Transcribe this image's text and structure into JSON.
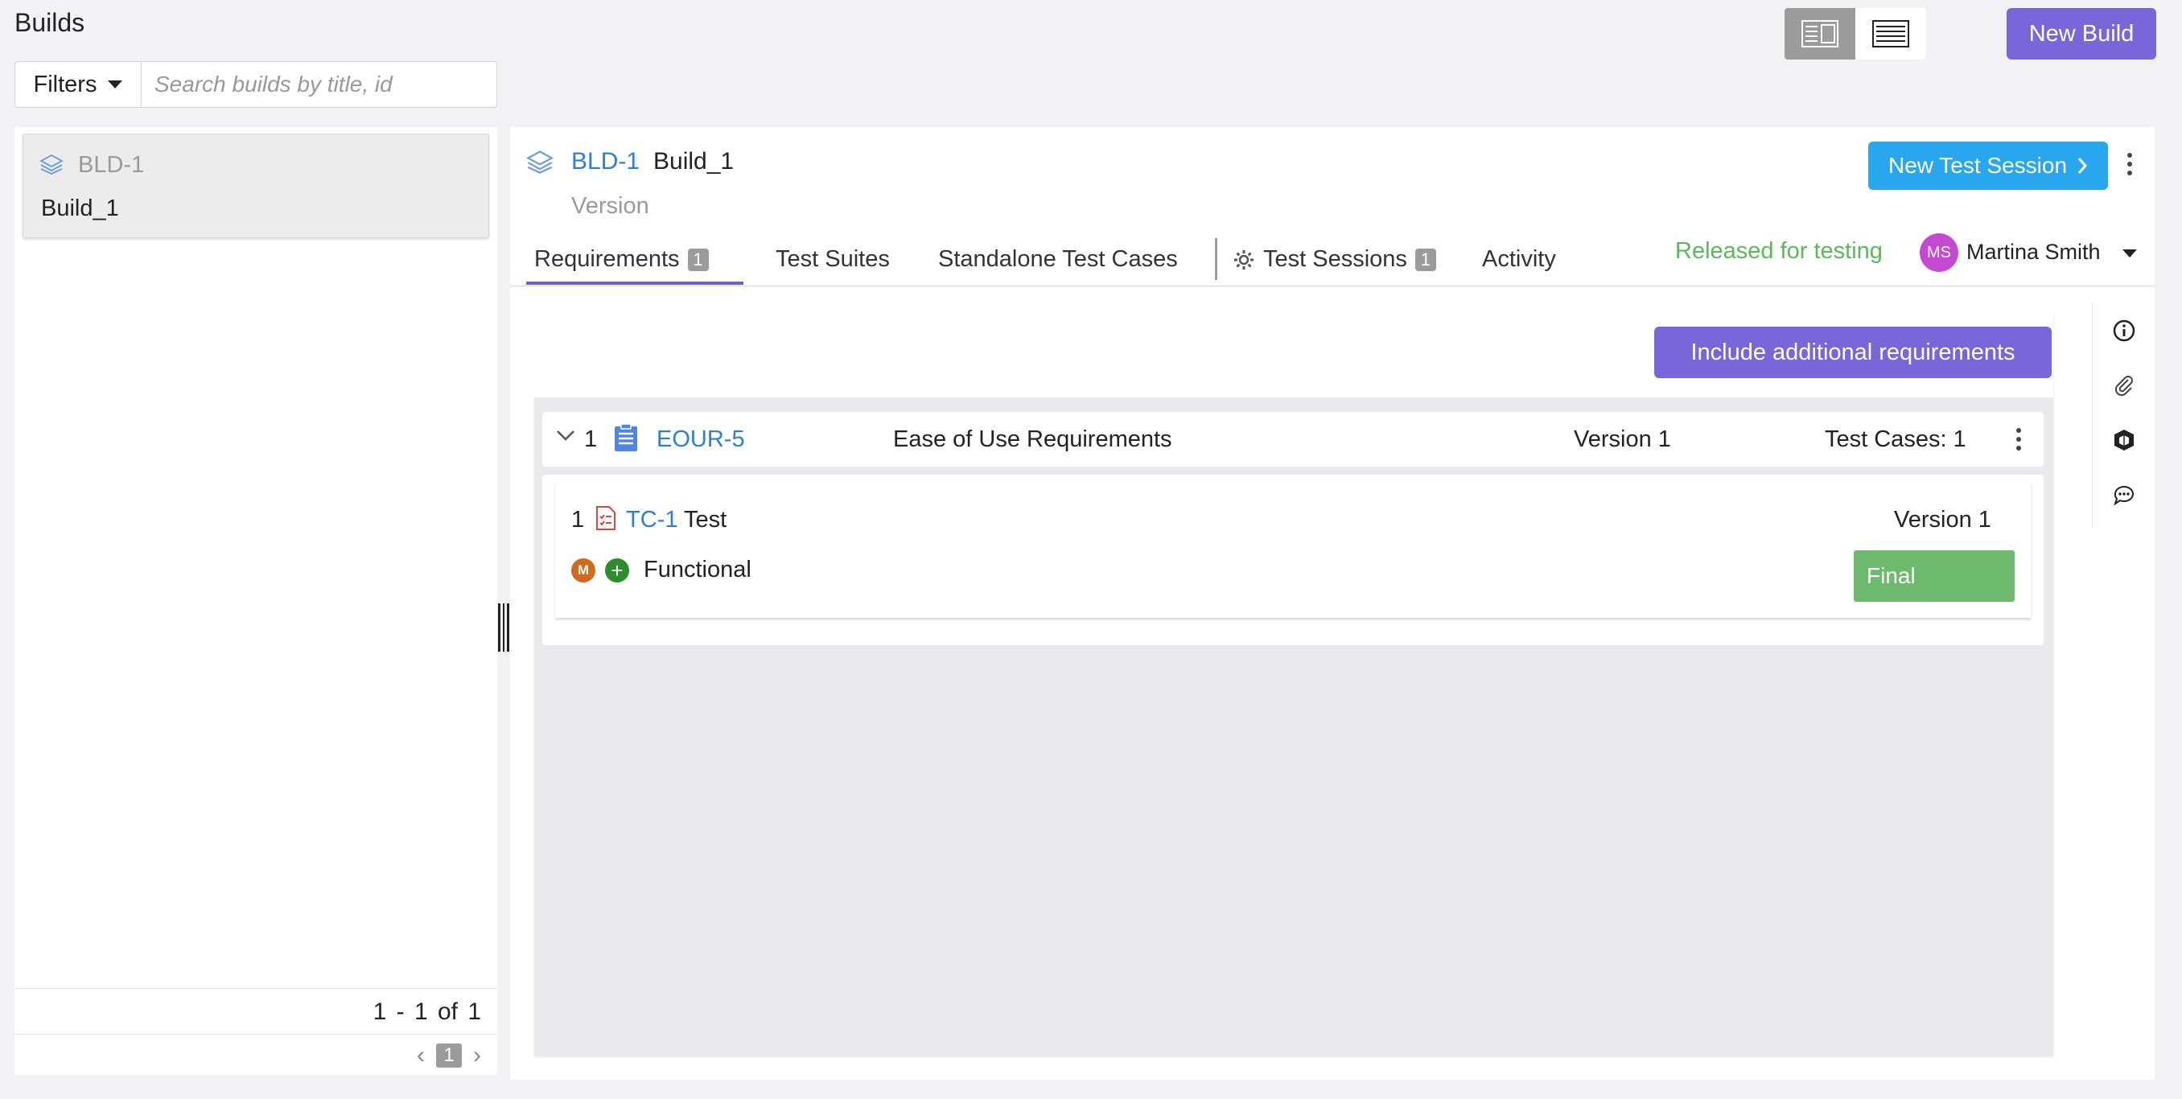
{
  "page": {
    "title": "Builds"
  },
  "toolbar": {
    "filters_label": "Filters",
    "search_placeholder": "Search builds by title, id",
    "new_build_label": "New Build"
  },
  "build_list": {
    "items": [
      {
        "id": "BLD-1",
        "name": "Build_1"
      }
    ],
    "count_text": "1 - 1  of  1",
    "current_page": "1"
  },
  "build_detail": {
    "id": "BLD-1",
    "name": "Build_1",
    "version_label": "Version",
    "new_session_label": "New Test Session",
    "status": "Released for testing",
    "owner": {
      "initials": "MS",
      "name": "Martina Smith"
    },
    "tabs": [
      {
        "label": "Requirements",
        "badge": "1"
      },
      {
        "label": "Test Suites"
      },
      {
        "label": "Standalone Test Cases"
      },
      {
        "label": "Test Sessions",
        "badge": "1"
      },
      {
        "label": "Activity"
      }
    ],
    "include_btn_label": "Include additional requirements"
  },
  "requirement": {
    "index": "1",
    "id": "EOUR-5",
    "title": "Ease of Use Requirements",
    "version": "Version 1",
    "test_cases": "Test Cases: 1"
  },
  "test_case": {
    "index": "1",
    "id": "TC-1",
    "name": "Test",
    "version": "Version 1",
    "priority_badge": "M",
    "type": "Functional",
    "status": "Final"
  },
  "colors": {
    "accent_purple": "#7966d9",
    "accent_blue": "#28a7ee",
    "link_blue": "#2d7fd6",
    "status_green": "#5cb85c",
    "final_green": "#6db96d"
  }
}
